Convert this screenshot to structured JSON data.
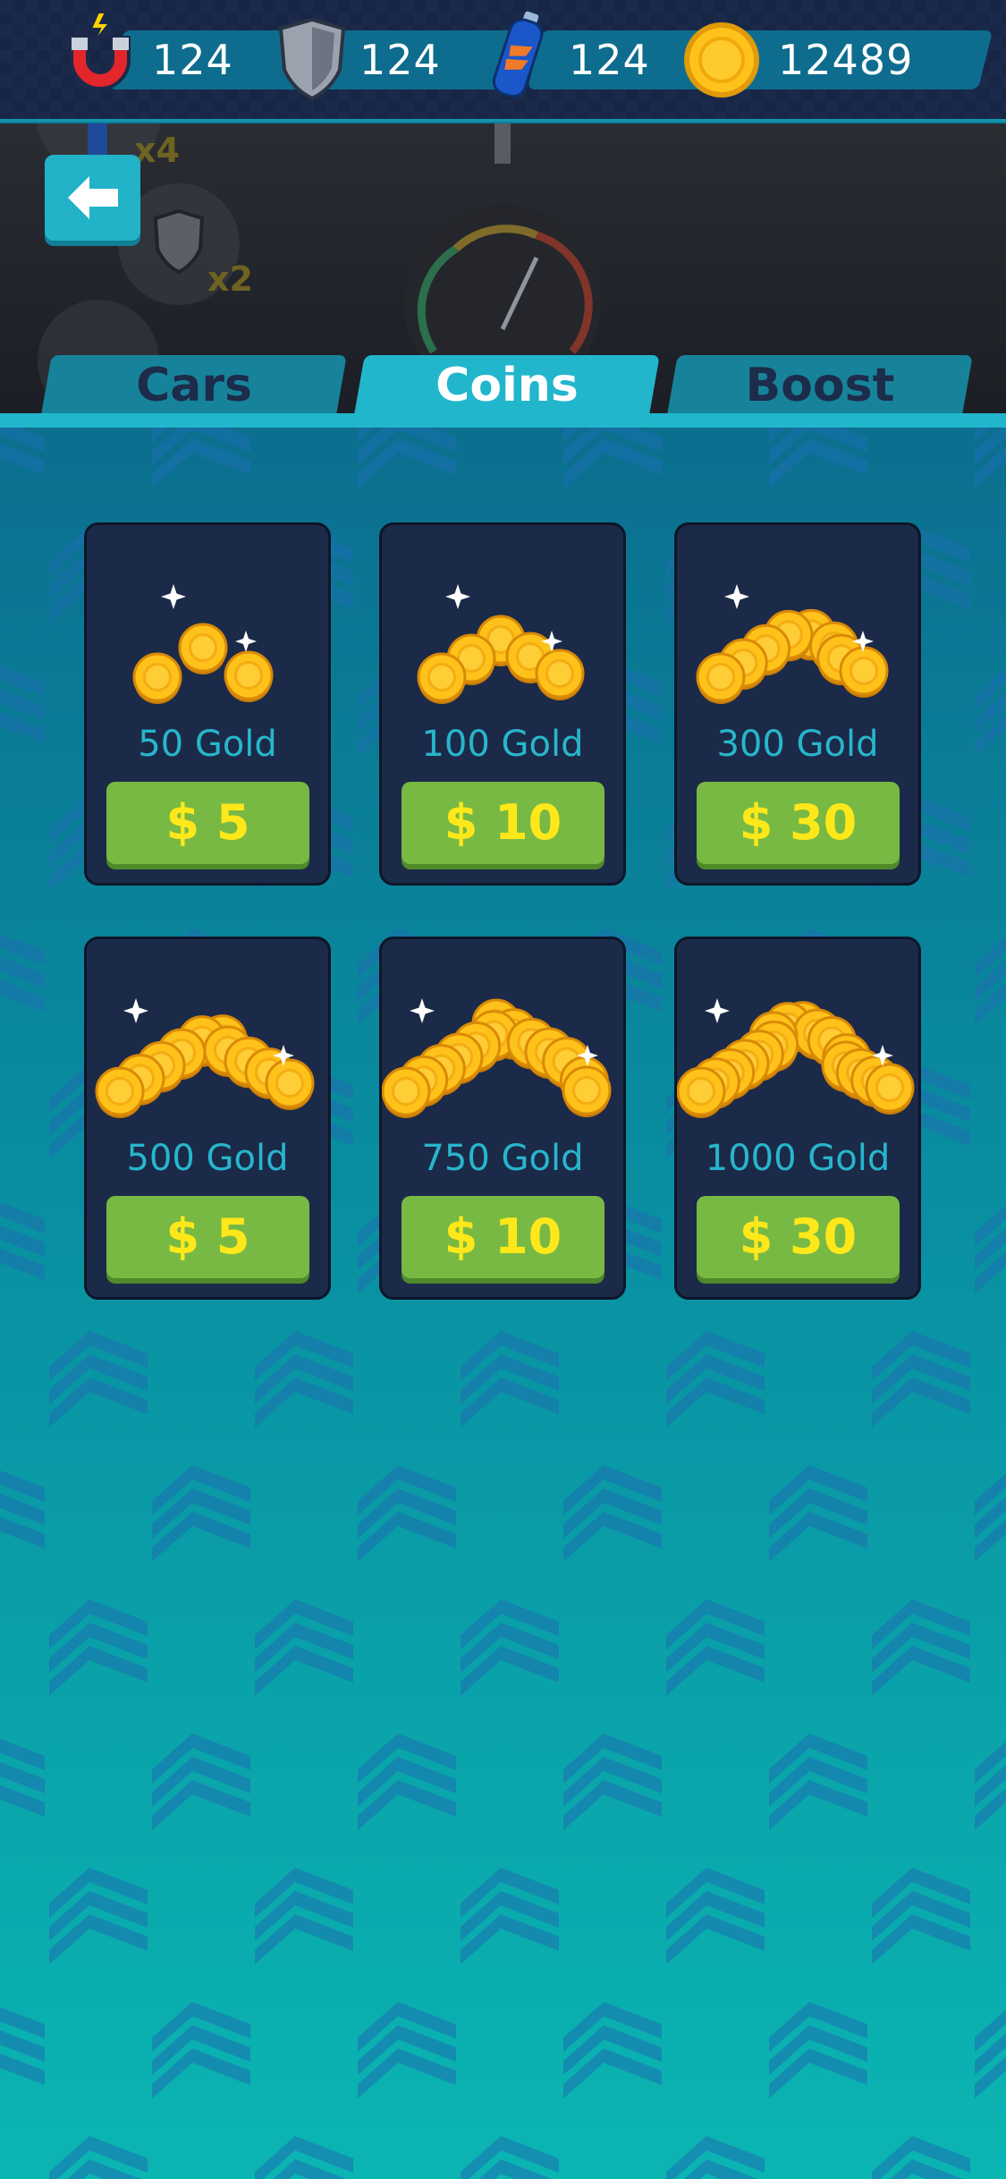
{
  "resources": [
    {
      "icon": "magnet-icon",
      "value": "124"
    },
    {
      "icon": "shield-icon",
      "value": "124"
    },
    {
      "icon": "nitro-bottle-icon",
      "value": "124"
    },
    {
      "icon": "gold-coin-icon",
      "value": "12489"
    }
  ],
  "tabs": [
    {
      "label": "Cars",
      "active": false
    },
    {
      "label": "Coins",
      "active": true
    },
    {
      "label": "Boost",
      "active": false
    }
  ],
  "packs": [
    {
      "label": "50 Gold",
      "price": "$ 5"
    },
    {
      "label": "100 Gold",
      "price": "$ 10"
    },
    {
      "label": "300 Gold",
      "price": "$ 30"
    },
    {
      "label": "500 Gold",
      "price": "$ 5"
    },
    {
      "label": "750 Gold",
      "price": "$ 10"
    },
    {
      "label": "1000 Gold",
      "price": "$ 30"
    }
  ],
  "scene": {
    "multiplier_1": "x4",
    "multiplier_2": "x2"
  },
  "colors": {
    "accent": "#22b6cc",
    "buy_button": "#78b944",
    "price_text": "#ffe81a",
    "card_bg": "#1b2a48"
  }
}
